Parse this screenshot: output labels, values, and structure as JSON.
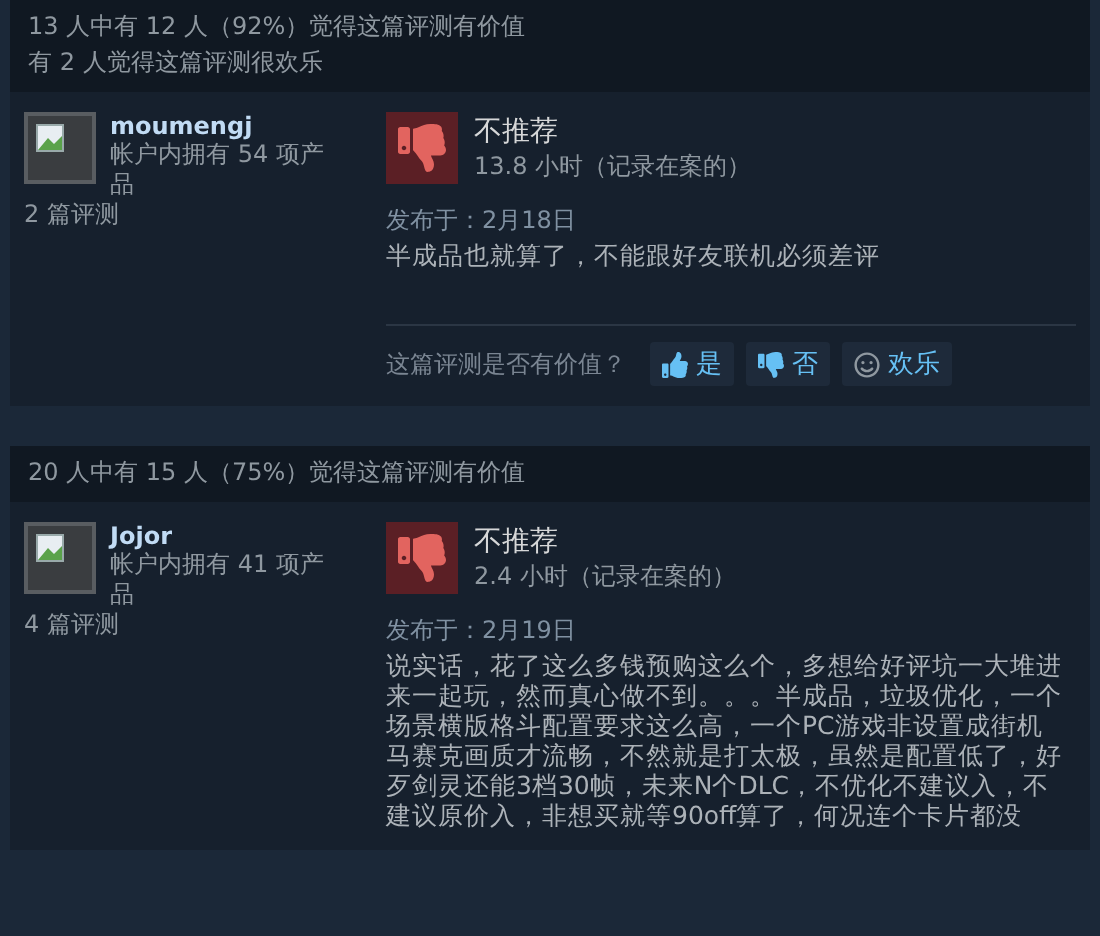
{
  "reviews": [
    {
      "helpful_summary": "13 人中有 12 人（92%）觉得这篇评测有价值",
      "funny_summary": "有 2 人觉得这篇评测很欢乐",
      "author": {
        "name": "moumengj",
        "products": "帐户内拥有 54 项产品",
        "reviews": "2 篇评测"
      },
      "recommended": false,
      "verdict": "不推荐",
      "hours": "13.8 小时（记录在案的）",
      "posted": "发布于：2月18日",
      "text": "半成品也就算了，不能跟好友联机必须差评",
      "vote_prompt": "这篇评测是否有价值？",
      "vote_buttons": [
        {
          "kind": "yes",
          "label": "是"
        },
        {
          "kind": "no",
          "label": "否"
        },
        {
          "kind": "funny",
          "label": "欢乐"
        }
      ]
    },
    {
      "helpful_summary": "20 人中有 15 人（75%）觉得这篇评测有价值",
      "author": {
        "name": "Jojor",
        "products": "帐户内拥有 41 项产品",
        "reviews": "4 篇评测"
      },
      "recommended": false,
      "verdict": "不推荐",
      "hours": "2.4 小时（记录在案的）",
      "posted": "发布于：2月19日",
      "text": "说实话，花了这么多钱预购这么个，多想给好评坑一大堆进来一起玩，然而真心做不到。。。半成品，垃圾优化，一个场景横版格斗配置要求这么高，一个PC游戏非设置成街机马赛克画质才流畅，不然就是打太极，虽然是配置低了，好歹剑灵还能3档30帧，未来N个DLC，不优化不建议入，不建议原价入，非想买就等90off算了，何况连个卡片都没"
    }
  ]
}
